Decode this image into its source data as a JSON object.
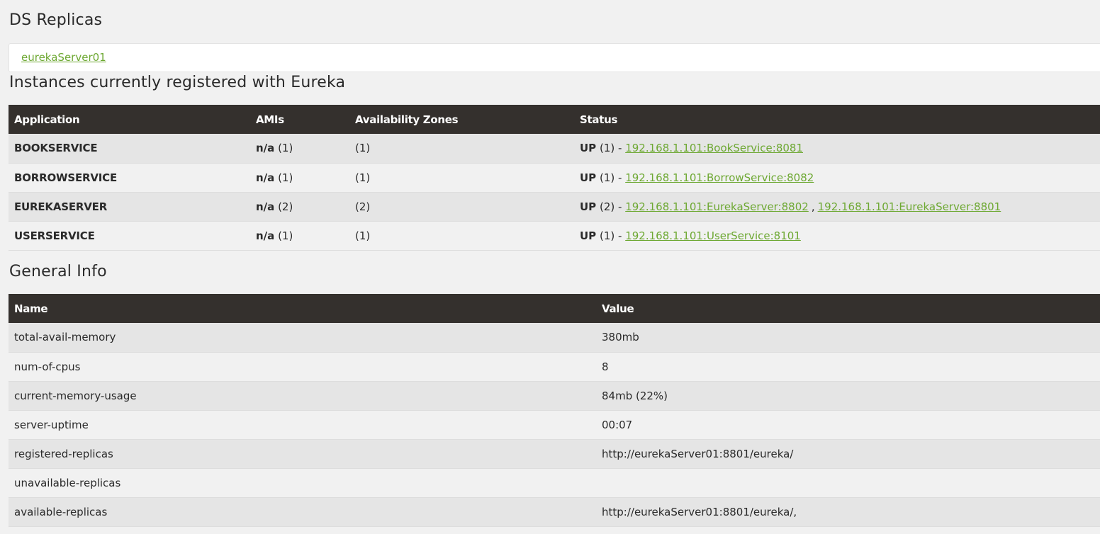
{
  "ds_replicas": {
    "title": "DS Replicas",
    "replica_link": "eurekaServer01"
  },
  "instances": {
    "title": "Instances currently registered with Eureka",
    "headers": {
      "application": "Application",
      "amis": "AMIs",
      "zones": "Availability Zones",
      "status": "Status"
    },
    "rows": [
      {
        "application": "BOOKSERVICE",
        "amis_label": "n/a",
        "amis_count": "(1)",
        "zones": "(1)",
        "status_label": "UP",
        "status_count": "(1)",
        "separator": "-",
        "links": [
          "192.168.1.101:BookService:8081"
        ]
      },
      {
        "application": "BORROWSERVICE",
        "amis_label": "n/a",
        "amis_count": "(1)",
        "zones": "(1)",
        "status_label": "UP",
        "status_count": "(1)",
        "separator": "-",
        "links": [
          "192.168.1.101:BorrowService:8082"
        ]
      },
      {
        "application": "EUREKASERVER",
        "amis_label": "n/a",
        "amis_count": "(2)",
        "zones": "(2)",
        "status_label": "UP",
        "status_count": "(2)",
        "separator": "-",
        "links": [
          "192.168.1.101:EurekaServer:8802",
          "192.168.1.101:EurekaServer:8801"
        ],
        "link_separator": ","
      },
      {
        "application": "USERSERVICE",
        "amis_label": "n/a",
        "amis_count": "(1)",
        "zones": "(1)",
        "status_label": "UP",
        "status_count": "(1)",
        "separator": "-",
        "links": [
          "192.168.1.101:UserService:8101"
        ]
      }
    ]
  },
  "general_info": {
    "title": "General Info",
    "headers": {
      "name": "Name",
      "value": "Value"
    },
    "rows": [
      {
        "name": "total-avail-memory",
        "value": "380mb"
      },
      {
        "name": "num-of-cpus",
        "value": "8"
      },
      {
        "name": "current-memory-usage",
        "value": "84mb (22%)"
      },
      {
        "name": "server-uptime",
        "value": "00:07"
      },
      {
        "name": "registered-replicas",
        "value": "http://eurekaServer01:8801/eureka/"
      },
      {
        "name": "unavailable-replicas",
        "value": ""
      },
      {
        "name": "available-replicas",
        "value": "http://eurekaServer01:8801/eureka/,"
      }
    ]
  },
  "colors": {
    "header_bg": "#34302d",
    "link": "#6da832",
    "page_bg": "#f1f1f1",
    "row_alt_bg": "#e5e5e5"
  }
}
